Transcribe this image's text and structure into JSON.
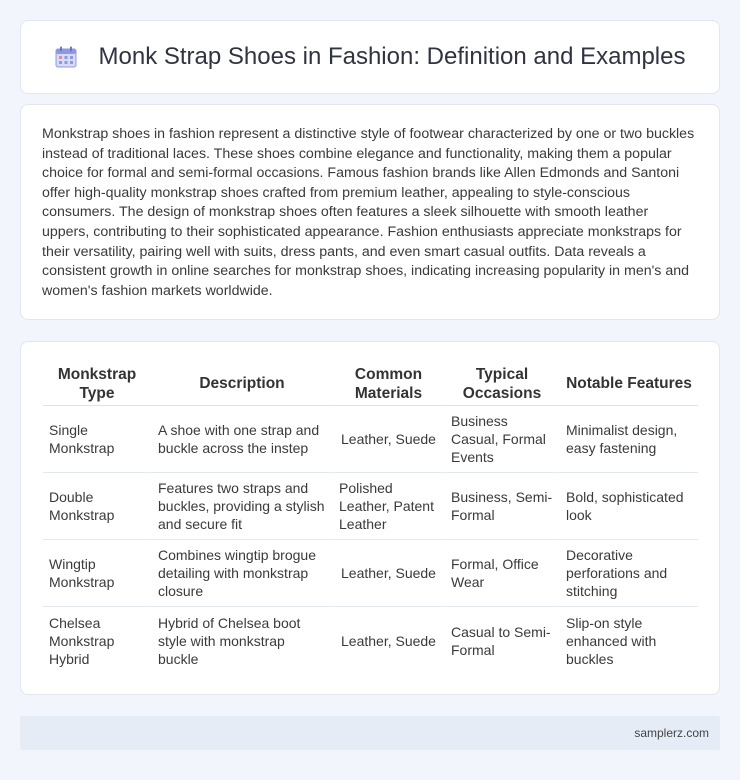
{
  "header": {
    "icon": "calendar-icon",
    "title": "Monk Strap Shoes in Fashion: Definition and Examples"
  },
  "intro": {
    "text": "Monkstrap shoes in fashion represent a distinctive style of footwear characterized by one or two buckles instead of traditional laces. These shoes combine elegance and functionality, making them a popular choice for formal and semi-formal occasions. Famous fashion brands like Allen Edmonds and Santoni offer high-quality monkstrap shoes crafted from premium leather, appealing to style-conscious consumers. The design of monkstrap shoes often features a sleek silhouette with smooth leather uppers, contributing to their sophisticated appearance. Fashion enthusiasts appreciate monkstraps for their versatility, pairing well with suits, dress pants, and even smart casual outfits. Data reveals a consistent growth in online searches for monkstrap shoes, indicating increasing popularity in men's and women's fashion markets worldwide."
  },
  "table": {
    "headers": [
      "Monkstrap Type",
      "Description",
      "Common Materials",
      "Typical Occasions",
      "Notable Features"
    ],
    "rows": [
      [
        "Single Monkstrap",
        "A shoe with one strap and buckle across the instep",
        "Leather, Suede",
        "Business Casual, Formal Events",
        "Minimalist design, easy fastening"
      ],
      [
        "Double Monkstrap",
        "Features two straps and buckles, providing a stylish and secure fit",
        "Polished Leather, Patent Leather",
        "Business, Semi-Formal",
        "Bold, sophisticated look"
      ],
      [
        "Wingtip Monkstrap",
        "Combines wingtip brogue detailing with monkstrap closure",
        "Leather, Suede",
        "Formal, Office Wear",
        "Decorative perforations and stitching"
      ],
      [
        "Chelsea Monkstrap Hybrid",
        "Hybrid of Chelsea boot style with monkstrap buckle",
        "Leather, Suede",
        "Casual to Semi-Formal",
        "Slip-on style enhanced with buckles"
      ]
    ]
  },
  "footer": {
    "text": "samplerz.com"
  }
}
